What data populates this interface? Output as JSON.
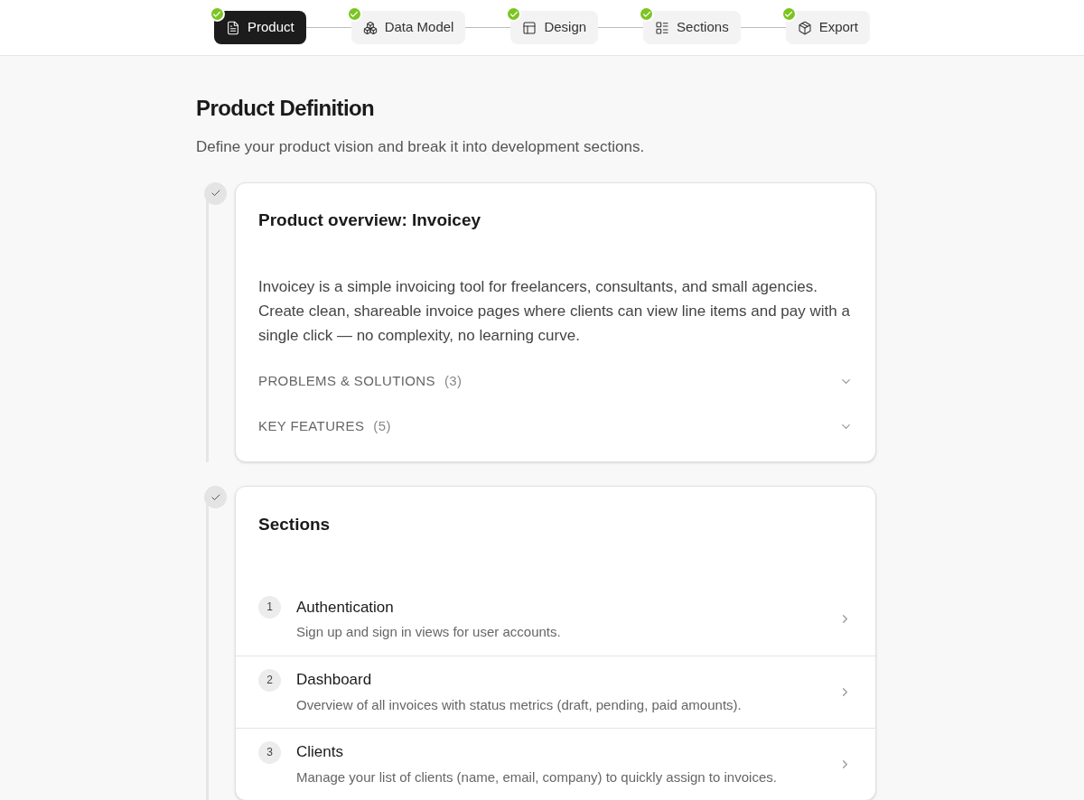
{
  "steps": [
    {
      "label": "Product",
      "selected": true,
      "done": true
    },
    {
      "label": "Data Model",
      "selected": false,
      "done": true
    },
    {
      "label": "Design",
      "selected": false,
      "done": true
    },
    {
      "label": "Sections",
      "selected": false,
      "done": true
    },
    {
      "label": "Export",
      "selected": false,
      "done": true
    }
  ],
  "page": {
    "title": "Product Definition",
    "subtitle": "Define your product vision and break it into development sections."
  },
  "overview": {
    "done": true,
    "title": "Product overview: Invoicey",
    "description": "Invoicey is a simple invoicing tool for freelancers, consultants, and small agencies. Create clean, shareable invoice pages where clients can view line items and pay with a single click — no complexity, no learning curve.",
    "groups": [
      {
        "label": "PROBLEMS & SOLUTIONS",
        "count": "(3)",
        "expanded": false
      },
      {
        "label": "KEY FEATURES",
        "count": "(5)",
        "expanded": false
      }
    ]
  },
  "sections": {
    "done": true,
    "title": "Sections",
    "items": [
      {
        "number": "1",
        "name": "Authentication",
        "description": "Sign up and sign in views for user accounts."
      },
      {
        "number": "2",
        "name": "Dashboard",
        "description": "Overview of all invoices with status metrics (draft, pending, paid amounts)."
      },
      {
        "number": "3",
        "name": "Clients",
        "description": "Manage your list of clients (name, email, company) to quickly assign to invoices."
      }
    ]
  }
}
